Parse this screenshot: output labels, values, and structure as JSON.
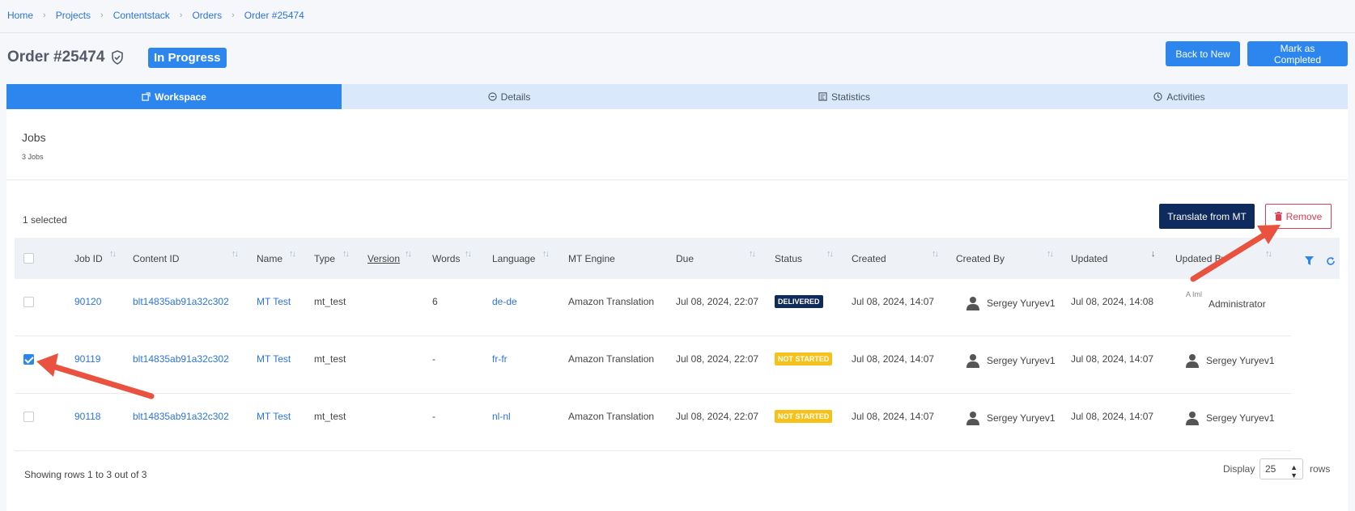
{
  "breadcrumb": [
    "Home",
    "Projects",
    "Contentstack",
    "Orders",
    "Order #25474"
  ],
  "order": {
    "title": "Order #25474",
    "status": "In Progress"
  },
  "actions": {
    "back": "Back to New",
    "complete": "Mark as Completed"
  },
  "tabs": [
    {
      "label": "Workspace",
      "icon": "workspace-icon"
    },
    {
      "label": "Details",
      "icon": "details-icon"
    },
    {
      "label": "Statistics",
      "icon": "statistics-icon"
    },
    {
      "label": "Activities",
      "icon": "activities-icon"
    }
  ],
  "jobs": {
    "title": "Jobs",
    "count": "3 Jobs",
    "selected": "1 selected",
    "translate_label": "Translate from MT",
    "remove_label": "Remove",
    "columns": [
      "Job ID",
      "Content ID",
      "Name",
      "Type",
      "Version",
      "Words",
      "Language",
      "MT Engine",
      "Due",
      "Status",
      "Created",
      "Created By",
      "Updated",
      "Updated By"
    ],
    "rows": [
      {
        "job_id": "90120",
        "content_id": "blt14835ab91a32c302",
        "name": "MT Test",
        "type": "mt_test",
        "version": "",
        "words": "6",
        "language": "de-de",
        "engine": "Amazon Translation",
        "due": "Jul 08, 2024, 22:07",
        "status": "DELIVERED",
        "created": "Jul 08, 2024, 14:07",
        "created_by": "Sergey Yuryev1",
        "updated": "Jul 08, 2024, 14:08",
        "updated_by": "Administrator",
        "updated_by_img_alt": "A\nIml",
        "checked": false
      },
      {
        "job_id": "90119",
        "content_id": "blt14835ab91a32c302",
        "name": "MT Test",
        "type": "mt_test",
        "version": "",
        "words": "-",
        "language": "fr-fr",
        "engine": "Amazon Translation",
        "due": "Jul 08, 2024, 22:07",
        "status": "NOT STARTED",
        "created": "Jul 08, 2024, 14:07",
        "created_by": "Sergey Yuryev1",
        "updated": "Jul 08, 2024, 14:07",
        "updated_by": "Sergey Yuryev1",
        "checked": true
      },
      {
        "job_id": "90118",
        "content_id": "blt14835ab91a32c302",
        "name": "MT Test",
        "type": "mt_test",
        "version": "",
        "words": "-",
        "language": "nl-nl",
        "engine": "Amazon Translation",
        "due": "Jul 08, 2024, 22:07",
        "status": "NOT STARTED",
        "created": "Jul 08, 2024, 14:07",
        "created_by": "Sergey Yuryev1",
        "updated": "Jul 08, 2024, 14:07",
        "updated_by": "Sergey Yuryev1",
        "checked": false
      }
    ]
  },
  "footer": {
    "showing": "Showing rows 1 to 3 out of 3",
    "display_label": "Display",
    "display_value": "25",
    "rows_label": "rows"
  },
  "colors": {
    "accent": "#2d86ee",
    "navy": "#0f2a5c",
    "danger": "#e03d53",
    "warning": "#f6c21a",
    "annotation": "#e8523e"
  }
}
